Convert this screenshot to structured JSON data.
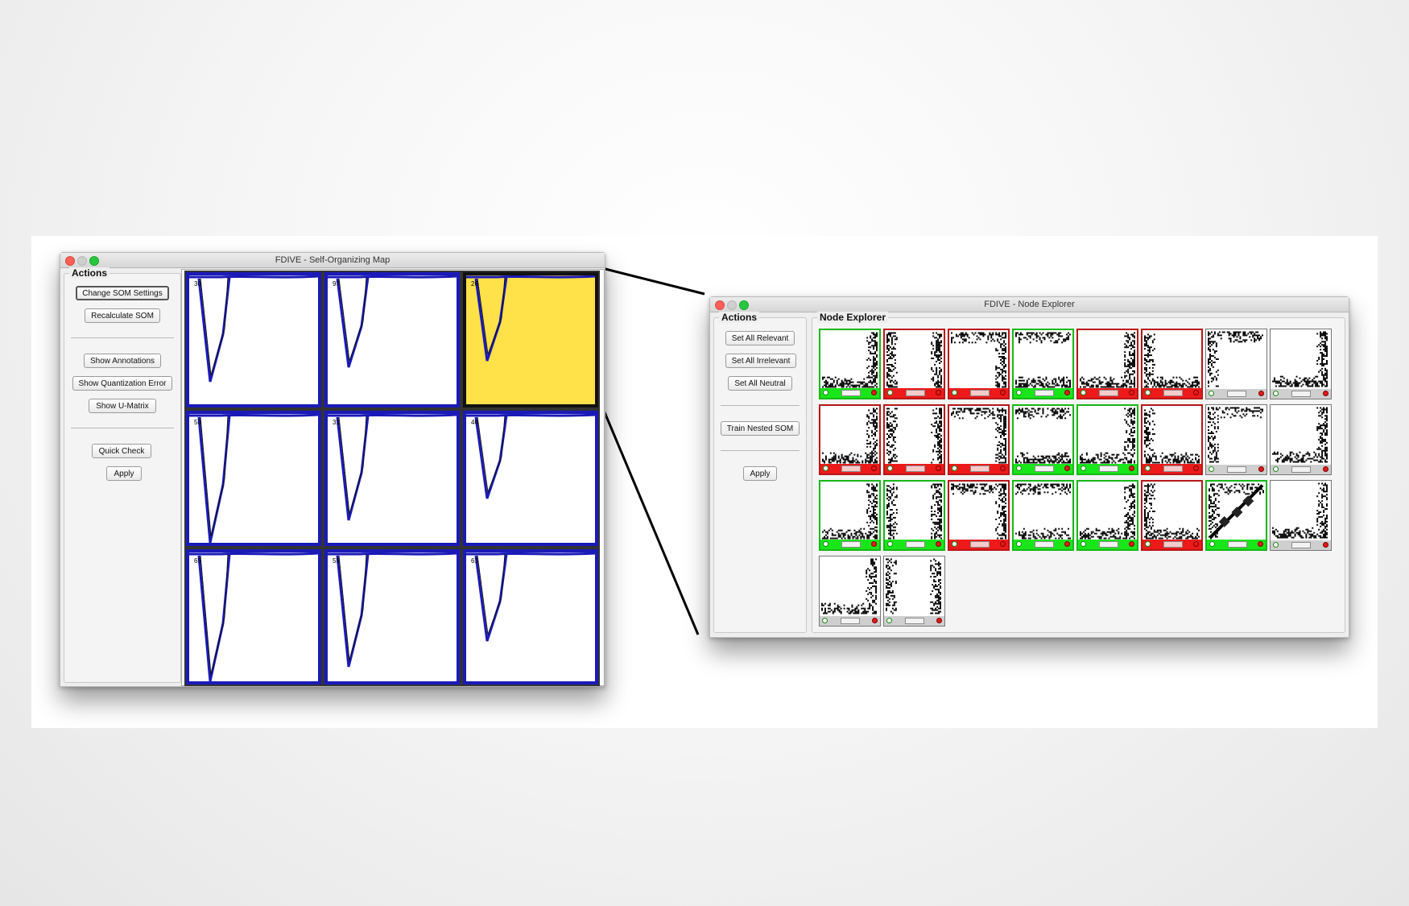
{
  "som_window": {
    "title": "FDIVE - Self-Organizing Map",
    "actions_title": "Actions",
    "buttons": {
      "change_settings": "Change SOM Settings",
      "recalculate": "Recalculate SOM",
      "show_annotations": "Show Annotations",
      "show_quantization": "Show Quantization Error",
      "show_umatrix": "Show U-Matrix",
      "quick_check": "Quick Check",
      "apply": "Apply"
    },
    "cells": [
      {
        "count": "30",
        "selected": false
      },
      {
        "count": "97",
        "selected": false
      },
      {
        "count": "26",
        "selected": true
      },
      {
        "count": "50",
        "selected": false
      },
      {
        "count": "31",
        "selected": false
      },
      {
        "count": "46",
        "selected": false
      },
      {
        "count": "65",
        "selected": false
      },
      {
        "count": "55",
        "selected": false
      },
      {
        "count": "61",
        "selected": false
      }
    ],
    "colors": {
      "series": "#1a1ab8",
      "selected": "#ffe14a"
    }
  },
  "node_window": {
    "title": "FDIVE - Node Explorer",
    "actions_title": "Actions",
    "explorer_title": "Node Explorer",
    "buttons": {
      "set_relevant": "Set All Relevant",
      "set_irrelevant": "Set All Irrelevant",
      "set_neutral": "Set All Neutral",
      "train_nested": "Train Nested SOM",
      "apply": "Apply"
    },
    "nodes": [
      "relevant",
      "irrelevant",
      "irrelevant",
      "relevant",
      "irrelevant",
      "irrelevant",
      "neutral",
      "neutral",
      "irrelevant",
      "irrelevant",
      "irrelevant",
      "relevant",
      "relevant",
      "irrelevant",
      "neutral",
      "neutral",
      "relevant",
      "relevant",
      "irrelevant",
      "relevant",
      "relevant",
      "irrelevant",
      "relevant",
      "neutral",
      "neutral",
      "neutral"
    ],
    "colors": {
      "relevant": "#19e619",
      "irrelevant": "#ee1a1a",
      "neutral": "#cfcfcf"
    }
  }
}
